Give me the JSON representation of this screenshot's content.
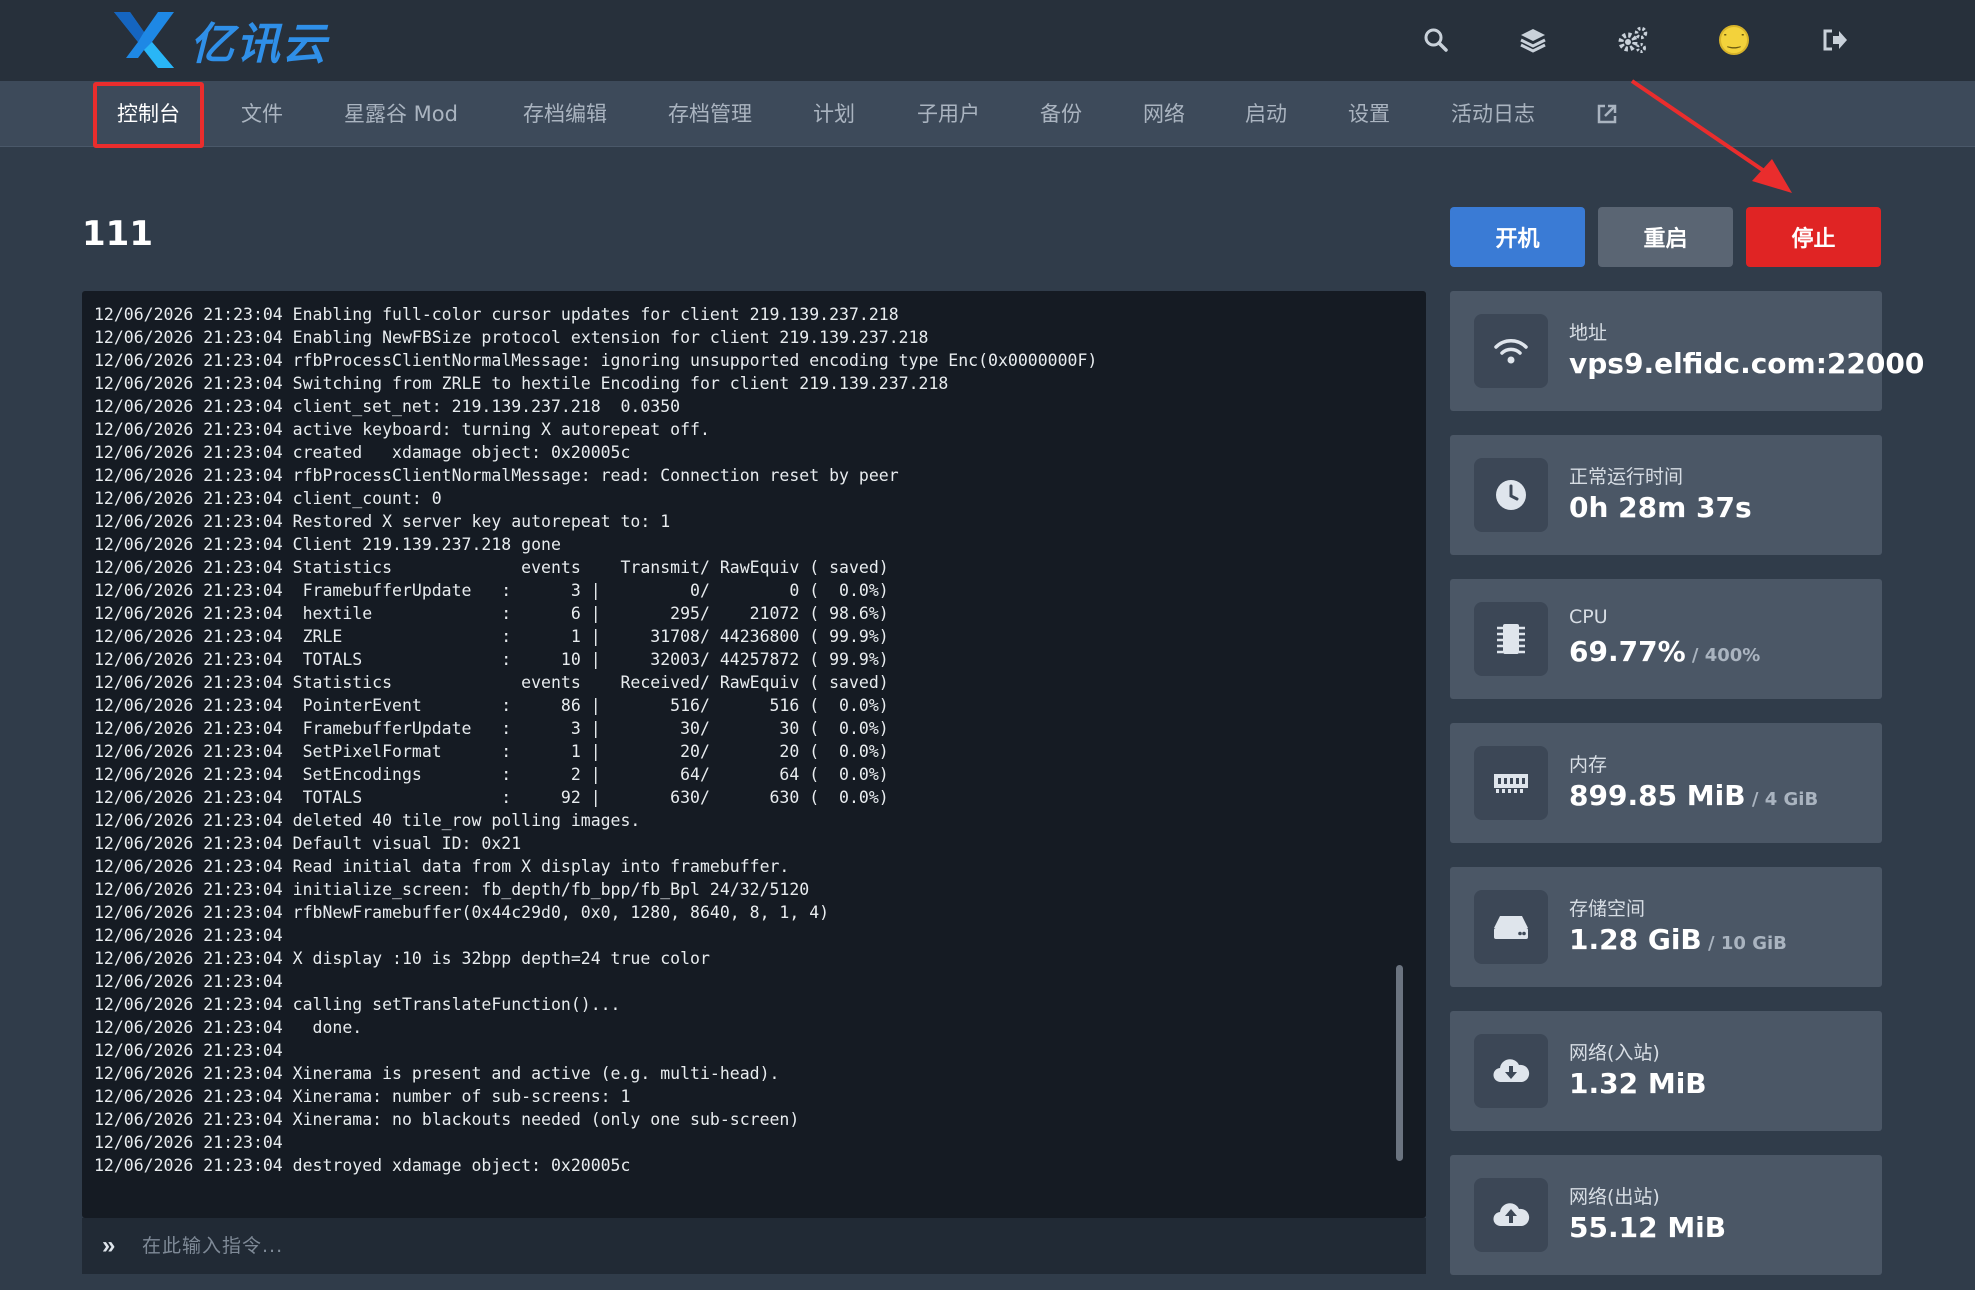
{
  "brand": {
    "name": "亿讯云"
  },
  "topbar": {
    "icons": [
      "search-icon",
      "layers-icon",
      "gears-icon",
      "avatar",
      "logout-icon"
    ],
    "avatar_glyph": "˙‿˙"
  },
  "nav": {
    "items": [
      {
        "label": "控制台",
        "active": true
      },
      {
        "label": "文件"
      },
      {
        "label": "星露谷 Mod"
      },
      {
        "label": "存档编辑"
      },
      {
        "label": "存档管理"
      },
      {
        "label": "计划"
      },
      {
        "label": "子用户"
      },
      {
        "label": "备份"
      },
      {
        "label": "网络"
      },
      {
        "label": "启动"
      },
      {
        "label": "设置"
      },
      {
        "label": "活动日志"
      }
    ],
    "external_icon": "external-link-icon"
  },
  "server": {
    "title": "111"
  },
  "actions": {
    "start": "开机",
    "restart": "重启",
    "stop": "停止"
  },
  "console": {
    "lines": [
      "12/06/2026 21:23:04 Enabling full-color cursor updates for client 219.139.237.218",
      "12/06/2026 21:23:04 Enabling NewFBSize protocol extension for client 219.139.237.218",
      "12/06/2026 21:23:04 rfbProcessClientNormalMessage: ignoring unsupported encoding type Enc(0x0000000F)",
      "12/06/2026 21:23:04 Switching from ZRLE to hextile Encoding for client 219.139.237.218",
      "12/06/2026 21:23:04 client_set_net: 219.139.237.218  0.0350",
      "12/06/2026 21:23:04 active keyboard: turning X autorepeat off.",
      "12/06/2026 21:23:04 created   xdamage object: 0x20005c",
      "12/06/2026 21:23:04 rfbProcessClientNormalMessage: read: Connection reset by peer",
      "12/06/2026 21:23:04 client_count: 0",
      "12/06/2026 21:23:04 Restored X server key autorepeat to: 1",
      "12/06/2026 21:23:04 Client 219.139.237.218 gone",
      "12/06/2026 21:23:04 Statistics             events    Transmit/ RawEquiv ( saved)",
      "12/06/2026 21:23:04  FramebufferUpdate   :      3 |         0/        0 (  0.0%)",
      "12/06/2026 21:23:04  hextile             :      6 |       295/    21072 ( 98.6%)",
      "12/06/2026 21:23:04  ZRLE                :      1 |     31708/ 44236800 ( 99.9%)",
      "12/06/2026 21:23:04  TOTALS              :     10 |     32003/ 44257872 ( 99.9%)",
      "12/06/2026 21:23:04 Statistics             events    Received/ RawEquiv ( saved)",
      "12/06/2026 21:23:04  PointerEvent        :     86 |       516/      516 (  0.0%)",
      "12/06/2026 21:23:04  FramebufferUpdate   :      3 |        30/       30 (  0.0%)",
      "12/06/2026 21:23:04  SetPixelFormat      :      1 |        20/       20 (  0.0%)",
      "12/06/2026 21:23:04  SetEncodings        :      2 |        64/       64 (  0.0%)",
      "12/06/2026 21:23:04  TOTALS              :     92 |       630/      630 (  0.0%)",
      "12/06/2026 21:23:04 deleted 40 tile_row polling images.",
      "12/06/2026 21:23:04 Default visual ID: 0x21",
      "12/06/2026 21:23:04 Read initial data from X display into framebuffer.",
      "12/06/2026 21:23:04 initialize_screen: fb_depth/fb_bpp/fb_Bpl 24/32/5120",
      "12/06/2026 21:23:04 rfbNewFramebuffer(0x44c29d0, 0x0, 1280, 8640, 8, 1, 4)",
      "12/06/2026 21:23:04",
      "12/06/2026 21:23:04 X display :10 is 32bpp depth=24 true color",
      "12/06/2026 21:23:04",
      "12/06/2026 21:23:04 calling setTranslateFunction()...",
      "12/06/2026 21:23:04   done.",
      "12/06/2026 21:23:04",
      "12/06/2026 21:23:04 Xinerama is present and active (e.g. multi-head).",
      "12/06/2026 21:23:04 Xinerama: number of sub-screens: 1",
      "12/06/2026 21:23:04 Xinerama: no blackouts needed (only one sub-screen)",
      "12/06/2026 21:23:04",
      "12/06/2026 21:23:04 destroyed xdamage object: 0x20005c"
    ],
    "prompt_glyph": "»",
    "input_placeholder": "在此输入指令...",
    "input_value": ""
  },
  "stats": [
    {
      "name": "address",
      "icon": "wifi-icon",
      "label": "地址",
      "value": "vps9.elfidc.com:22000",
      "sub": ""
    },
    {
      "name": "uptime",
      "icon": "clock-icon",
      "label": "正常运行时间",
      "value": "0h 28m 37s",
      "sub": ""
    },
    {
      "name": "cpu",
      "icon": "cpu-icon",
      "label": "CPU",
      "value": "69.77%",
      "sub": " / 400%"
    },
    {
      "name": "memory",
      "icon": "memory-icon",
      "label": "内存",
      "value": "899.85 MiB",
      "sub": " / 4 GiB"
    },
    {
      "name": "storage",
      "icon": "hdd-icon",
      "label": "存储空间",
      "value": "1.28 GiB",
      "sub": " / 10 GiB"
    },
    {
      "name": "network-in",
      "icon": "cloud-download-icon",
      "label": "网络(入站)",
      "value": "1.32 MiB",
      "sub": ""
    },
    {
      "name": "network-out",
      "icon": "cloud-upload-icon",
      "label": "网络(出站)",
      "value": "55.12 MiB",
      "sub": ""
    }
  ],
  "colors": {
    "accent": "#3a7bd5",
    "danger": "#e02424",
    "highlight_annotation": "#ea2d2d"
  }
}
